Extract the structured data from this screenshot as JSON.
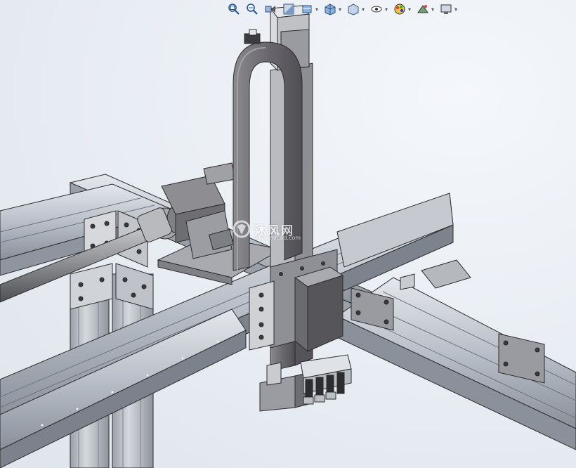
{
  "app": {
    "type": "cad-3d-viewport"
  },
  "heads_up_toolbar": {
    "buttons": [
      {
        "icon": "zoom-to-fit-icon",
        "dropdown": false
      },
      {
        "icon": "zoom-to-area-icon",
        "dropdown": false
      },
      {
        "icon": "previous-view-icon",
        "dropdown": false
      },
      {
        "icon": "section-view-icon",
        "dropdown": false
      },
      {
        "icon": "dynamic-annotation-views-icon",
        "dropdown": true
      },
      {
        "icon": "view-orientation-icon",
        "dropdown": true
      },
      {
        "icon": "display-style-icon",
        "dropdown": true
      },
      {
        "icon": "hide-show-items-icon",
        "dropdown": true
      },
      {
        "icon": "edit-appearance-icon",
        "dropdown": true
      },
      {
        "icon": "apply-scene-icon",
        "dropdown": true
      },
      {
        "icon": "view-settings-icon",
        "dropdown": true
      }
    ]
  },
  "model": {
    "description_icon": "gantry-robot-assembly",
    "colors": {
      "frame": "#c9ced6",
      "frame_dark": "#7c8390",
      "plate": "#a9aab0",
      "casting": "#6f6e73",
      "motor": "#8e8e92",
      "edge": "#2b2b2b"
    }
  },
  "watermark": {
    "text": "沐风网",
    "url": "www.mfcad.com"
  }
}
